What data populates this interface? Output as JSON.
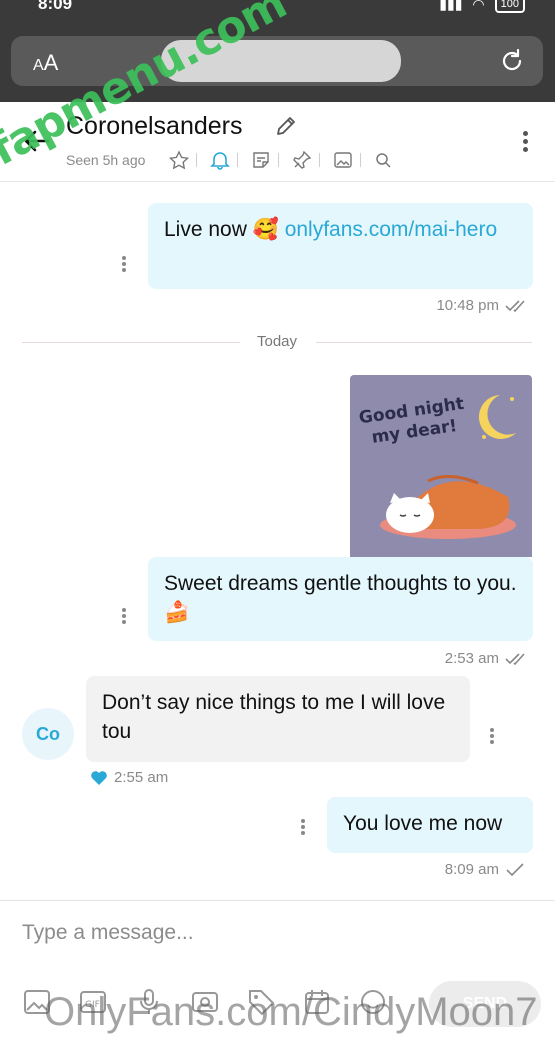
{
  "status_bar": {
    "time": "8:09",
    "battery": "100"
  },
  "browser": {
    "text_size_label_small": "A",
    "text_size_label_large": "A"
  },
  "chat": {
    "contact_name": "Coronelsanders",
    "last_seen": "Seen 5h ago",
    "icons": [
      "star-icon",
      "bell-icon",
      "note-icon",
      "pin-icon",
      "image-icon",
      "search-icon"
    ],
    "accent_color": "#2aa9d6"
  },
  "messages": {
    "m1": {
      "text": "Live now 🥰 ",
      "link": "onlyfans.com/mai-hero",
      "time": "10:48 pm",
      "status": "read"
    },
    "day_divider": "Today",
    "m2": {
      "sticker_text": "Good night my dear!"
    },
    "m3": {
      "text": "Sweet dreams gentle thoughts to you. 🍰",
      "time": "2:53 am",
      "status": "read"
    },
    "m4": {
      "avatar_initials": "Co",
      "text": "Don’t say nice things to me I will love tou",
      "time": "2:55 am",
      "liked": true
    },
    "m5": {
      "text": "You love me now",
      "time": "8:09 am",
      "status": "sent"
    }
  },
  "composer": {
    "placeholder": "Type a message...",
    "send_label": "SEND",
    "tools": [
      "image-icon",
      "gif-icon",
      "microphone-icon",
      "vault-icon",
      "price-tag-icon",
      "calendar-icon",
      "emoji-icon"
    ]
  },
  "watermarks": {
    "top": "fapmenu.com",
    "bottom": "OnlyFans.com/CindyMoon7"
  }
}
